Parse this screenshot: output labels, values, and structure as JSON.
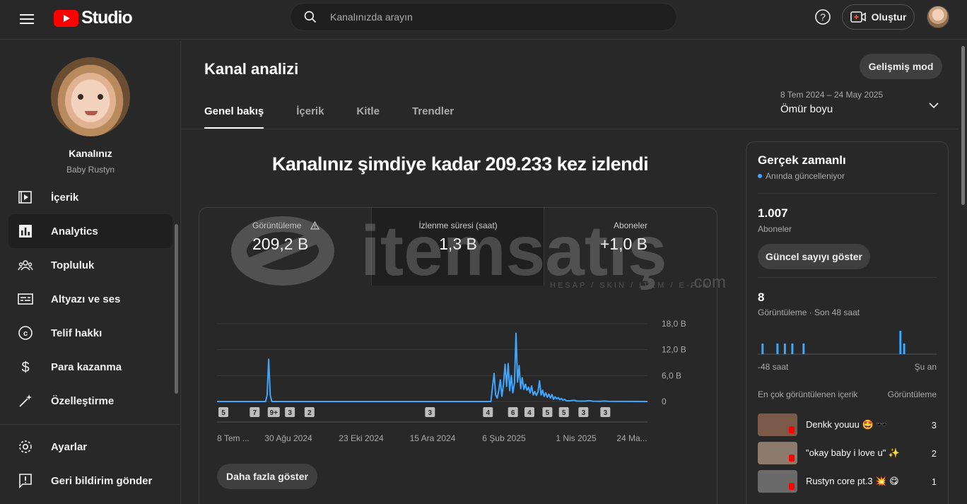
{
  "app": {
    "logo_text": "Studio"
  },
  "search": {
    "placeholder": "Kanalınızda arayın"
  },
  "header": {
    "create_label": "Oluştur"
  },
  "channel": {
    "title": "Kanalınız",
    "name": "Baby Rustyn"
  },
  "sidebar": {
    "items": [
      {
        "label": "İçerik",
        "icon": "content-icon"
      },
      {
        "label": "Analytics",
        "icon": "analytics-icon",
        "active": true
      },
      {
        "label": "Topluluk",
        "icon": "community-icon"
      },
      {
        "label": "Altyazı ve ses",
        "icon": "subtitles-icon"
      },
      {
        "label": "Telif hakkı",
        "icon": "copyright-icon"
      },
      {
        "label": "Para kazanma",
        "icon": "monetization-icon"
      },
      {
        "label": "Özelleştirme",
        "icon": "customization-icon"
      }
    ],
    "bottom": [
      {
        "label": "Ayarlar",
        "icon": "settings-icon"
      },
      {
        "label": "Geri bildirim gönder",
        "icon": "feedback-icon"
      }
    ]
  },
  "page": {
    "title": "Kanal analizi",
    "advanced_button": "Gelişmiş mod",
    "tabs": [
      "Genel bakış",
      "İçerik",
      "Kitle",
      "Trendler"
    ],
    "date_range": {
      "range": "8 Tem 2024 – 24 May 2025",
      "label": "Ömür boyu"
    },
    "headline": "Kanalınız şimdiye kadar 209.233 kez izlendi",
    "metrics": [
      {
        "label": "Görüntüleme",
        "value": "209,2 B"
      },
      {
        "label": "İzlenme süresi (saat)",
        "value": "1,3 B"
      },
      {
        "label": "Aboneler",
        "value": "+1,0 B"
      }
    ],
    "more_button": "Daha fazla göster"
  },
  "watermark": {
    "text": "itemsatış",
    "sub": "HESAP / SKIN / ITEM / E-PIN",
    "domain": ".com"
  },
  "chart_data": {
    "type": "line",
    "x_tick_labels": [
      "8 Tem ...",
      "30 Ağu 2024",
      "23 Eki 2024",
      "15 Ara 2024",
      "6 Şub 2025",
      "1 Nis 2025",
      "24 Ma..."
    ],
    "y_tick_labels": [
      "18,0 B",
      "12,0 B",
      "6,0 B",
      "0"
    ],
    "ylim": [
      0,
      18000
    ],
    "series": [
      {
        "color": "#3ea6ff",
        "values_by_day_index": [
          [
            0,
            0
          ],
          [
            62,
            0
          ],
          [
            64,
            1500
          ],
          [
            66,
            9800
          ],
          [
            68,
            1500
          ],
          [
            70,
            0
          ],
          [
            350,
            0
          ],
          [
            352,
            3500
          ],
          [
            354,
            6500
          ],
          [
            356,
            1500
          ],
          [
            358,
            800
          ],
          [
            360,
            2500
          ],
          [
            362,
            5000
          ],
          [
            364,
            1200
          ],
          [
            366,
            4000
          ],
          [
            368,
            8600
          ],
          [
            370,
            3500
          ],
          [
            372,
            8800
          ],
          [
            374,
            2500
          ],
          [
            376,
            6000
          ],
          [
            378,
            2000
          ],
          [
            380,
            4200
          ],
          [
            382,
            15800
          ],
          [
            384,
            4500
          ],
          [
            386,
            8300
          ],
          [
            388,
            3000
          ],
          [
            390,
            5500
          ],
          [
            392,
            2800
          ],
          [
            394,
            4000
          ],
          [
            396,
            2600
          ],
          [
            398,
            3300
          ],
          [
            400,
            2000
          ],
          [
            402,
            3600
          ],
          [
            404,
            1500
          ],
          [
            406,
            2300
          ],
          [
            408,
            1400
          ],
          [
            410,
            2200
          ],
          [
            412,
            4800
          ],
          [
            414,
            1500
          ],
          [
            416,
            2600
          ],
          [
            418,
            1200
          ],
          [
            420,
            2000
          ],
          [
            422,
            1000
          ],
          [
            424,
            1700
          ],
          [
            426,
            800
          ],
          [
            428,
            1600
          ],
          [
            430,
            500
          ],
          [
            432,
            1100
          ],
          [
            434,
            600
          ],
          [
            436,
            900
          ],
          [
            438,
            400
          ],
          [
            440,
            700
          ],
          [
            442,
            300
          ],
          [
            444,
            500
          ],
          [
            446,
            200
          ],
          [
            450,
            150
          ],
          [
            456,
            300
          ],
          [
            460,
            100
          ],
          [
            470,
            80
          ],
          [
            476,
            200
          ],
          [
            480,
            60
          ],
          [
            490,
            40
          ],
          [
            495,
            100
          ],
          [
            500,
            30
          ],
          [
            520,
            10
          ],
          [
            550,
            0
          ]
        ]
      }
    ],
    "markers": [
      {
        "day_index": 0,
        "label": "5"
      },
      {
        "day_index": 40,
        "label": "7"
      },
      {
        "day_index": 63,
        "label": "9+"
      },
      {
        "day_index": 85,
        "label": "3"
      },
      {
        "day_index": 110,
        "label": "2"
      },
      {
        "day_index": 264,
        "label": "3"
      },
      {
        "day_index": 338,
        "label": "4"
      },
      {
        "day_index": 370,
        "label": "6"
      },
      {
        "day_index": 391,
        "label": "4"
      },
      {
        "day_index": 414,
        "label": "5"
      },
      {
        "day_index": 435,
        "label": "5"
      },
      {
        "day_index": 460,
        "label": "3"
      },
      {
        "day_index": 488,
        "label": "3"
      }
    ]
  },
  "realtime": {
    "title": "Gerçek zamanlı",
    "live": "Anında güncelleniyor",
    "subs_value": "1.007",
    "subs_label": "Aboneler",
    "show_button": "Güncel sayıyı göster",
    "views_value": "8",
    "views_label": "Görüntüleme · Son 48 saat",
    "axis_left": "-48 saat",
    "axis_right": "Şu an",
    "bars": [
      [
        1,
        15
      ],
      [
        5,
        15
      ],
      [
        7,
        15
      ],
      [
        9,
        15
      ],
      [
        12,
        15
      ],
      [
        38,
        33
      ],
      [
        39,
        15
      ]
    ],
    "top_header": "En çok görüntülenen içerik",
    "top_header_right": "Görüntüleme",
    "top_items": [
      {
        "title": "Denkk youuu 🤩 🕶️",
        "views": "3",
        "thumb_color": "#7b5a4a"
      },
      {
        "title": "\"okay baby i love u\" ✨",
        "views": "2",
        "thumb_color": "#8c7a6c"
      },
      {
        "title": "Rustyn core pt.3 💥 😋",
        "views": "1",
        "thumb_color": "#6a6a6a"
      }
    ]
  }
}
